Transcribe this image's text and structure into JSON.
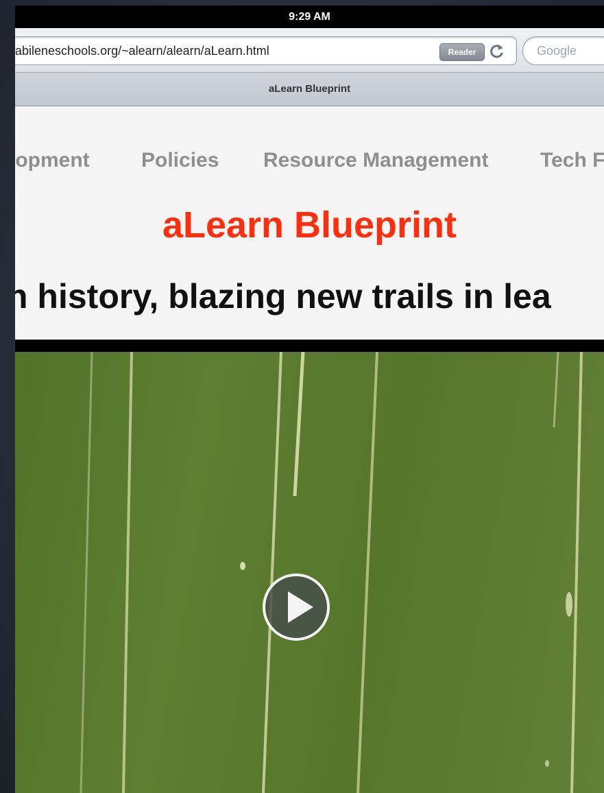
{
  "status_bar": {
    "time": "9:29 AM"
  },
  "toolbar": {
    "url": ".abileneschools.org/~alearn/alearn/aLearn.html",
    "reader_label": "Reader",
    "search_placeholder": "Google"
  },
  "tab": {
    "title": "aLearn Blueprint"
  },
  "nav": {
    "items": [
      "lopment",
      "Policies",
      "Resource Management",
      "Tech F"
    ]
  },
  "page": {
    "title": "aLearn Blueprint",
    "headline": "n history, blazing new trails in lea"
  },
  "colors": {
    "title_red": "#fb2f0e",
    "nav_gray": "#8f8f8f",
    "video_green": "#5f7f30"
  },
  "icons": {
    "reload": "reload-icon",
    "play": "play-icon"
  }
}
